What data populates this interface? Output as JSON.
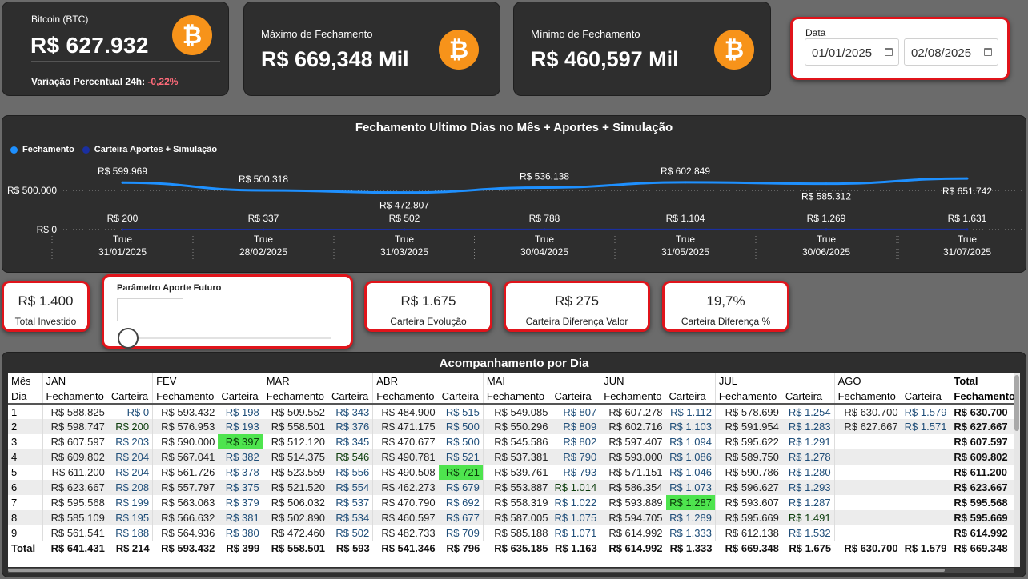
{
  "btc_card": {
    "title": "Bitcoin (BTC)",
    "price": "R$ 627.932",
    "variation_label": "Variação Percentual 24h:",
    "variation_value": "-0,22%",
    "icon": "bitcoin-icon"
  },
  "max_card": {
    "title": "Máximo de Fechamento",
    "value": "R$ 669,348 Mil",
    "icon": "bitcoin-icon"
  },
  "min_card": {
    "title": "Mínimo de Fechamento",
    "value": "R$ 460,597 Mil",
    "icon": "bitcoin-icon"
  },
  "date_filter": {
    "title": "Data",
    "start": "01/01/2025",
    "end": "02/08/2025"
  },
  "chart": {
    "title": "Fechamento Ultimo Dias no Mês + Aportes + Simulação",
    "legend": [
      {
        "name": "Fechamento",
        "color": "#1e90ff"
      },
      {
        "name": "Carteira Aportes + Simulação",
        "color": "#1a2fa0"
      }
    ],
    "y_ticks": [
      "R$ 500.000",
      "R$ 0"
    ],
    "x_labels_top": [
      "True",
      "True",
      "True",
      "True",
      "True",
      "True",
      "True"
    ],
    "x_labels_bottom": [
      "31/01/2025",
      "28/02/2025",
      "31/03/2025",
      "30/04/2025",
      "31/05/2025",
      "30/06/2025",
      "31/07/2025"
    ],
    "fech_labels": [
      "R$ 599.969",
      "R$ 500.318",
      "R$ 472.807",
      "R$ 536.138",
      "R$ 602.849",
      "R$ 585.312",
      "R$ 651.742"
    ],
    "cart_labels": [
      "R$ 200",
      "R$ 337",
      "R$ 502",
      "R$ 788",
      "R$ 1.104",
      "R$ 1.269",
      "R$ 1.631"
    ]
  },
  "chart_data": {
    "type": "line",
    "title": "Fechamento Ultimo Dias no Mês + Aportes + Simulação",
    "x": [
      "31/01/2025",
      "28/02/2025",
      "31/03/2025",
      "30/04/2025",
      "31/05/2025",
      "30/06/2025",
      "31/07/2025"
    ],
    "series": [
      {
        "name": "Fechamento",
        "values": [
          599969,
          500318,
          472807,
          536138,
          602849,
          585312,
          651742
        ]
      },
      {
        "name": "Carteira Aportes + Simulação",
        "values": [
          200,
          337,
          502,
          788,
          1104,
          1269,
          1631
        ]
      }
    ]
  },
  "kpis": {
    "total_investido": {
      "value": "R$ 1.400",
      "label": "Total Investido"
    },
    "evolucao": {
      "value": "R$ 1.675",
      "label": "Carteira Evolução"
    },
    "dif_valor": {
      "value": "R$ 275",
      "label": "Carteira Diferença Valor"
    },
    "dif_pct": {
      "value": "19,7%",
      "label": "Carteira Diferença %"
    }
  },
  "slider": {
    "title": "Parâmetro Aporte Futuro",
    "value": ""
  },
  "table": {
    "title": "Acompanhamento por Dia",
    "mes_label": "Mês",
    "dia_label": "Dia",
    "fech_label": "Fechamento",
    "cart_label": "Carteira",
    "total_label": "Total",
    "fech_total_label": "Fechamento",
    "months": [
      "JAN",
      "FEV",
      "MAR",
      "ABR",
      "MAI",
      "JUN",
      "JUL",
      "AGO"
    ],
    "rows": [
      {
        "dia": "1",
        "vals": [
          [
            "R$ 588.825",
            "R$ 0"
          ],
          [
            "R$ 593.432",
            "R$ 198"
          ],
          [
            "R$ 509.552",
            "R$ 343"
          ],
          [
            "R$ 484.900",
            "R$ 515"
          ],
          [
            "R$ 549.085",
            "R$ 807"
          ],
          [
            "R$ 607.278",
            "R$ 1.112"
          ],
          [
            "R$ 578.699",
            "R$ 1.254"
          ],
          [
            "R$ 630.700",
            "R$ 1.579"
          ]
        ],
        "total": "R$ 630.700"
      },
      {
        "dia": "2",
        "vals": [
          [
            "R$ 598.747",
            "R$ 200"
          ],
          [
            "R$ 576.953",
            "R$ 193"
          ],
          [
            "R$ 558.501",
            "R$ 376"
          ],
          [
            "R$ 471.175",
            "R$ 500"
          ],
          [
            "R$ 550.296",
            "R$ 809"
          ],
          [
            "R$ 602.716",
            "R$ 1.103"
          ],
          [
            "R$ 591.954",
            "R$ 1.283"
          ],
          [
            "R$ 627.667",
            "R$ 1.571"
          ]
        ],
        "total": "R$ 627.667"
      },
      {
        "dia": "3",
        "vals": [
          [
            "R$ 607.597",
            "R$ 203"
          ],
          [
            "R$ 590.000",
            "R$ 397"
          ],
          [
            "R$ 512.120",
            "R$ 345"
          ],
          [
            "R$ 470.677",
            "R$ 500"
          ],
          [
            "R$ 545.586",
            "R$ 802"
          ],
          [
            "R$ 597.407",
            "R$ 1.094"
          ],
          [
            "R$ 595.622",
            "R$ 1.291"
          ],
          [
            "",
            ""
          ]
        ],
        "total": "R$ 607.597"
      },
      {
        "dia": "4",
        "vals": [
          [
            "R$ 609.802",
            "R$ 204"
          ],
          [
            "R$ 567.041",
            "R$ 382"
          ],
          [
            "R$ 514.375",
            "R$ 546"
          ],
          [
            "R$ 490.781",
            "R$ 521"
          ],
          [
            "R$ 537.381",
            "R$ 790"
          ],
          [
            "R$ 593.000",
            "R$ 1.086"
          ],
          [
            "R$ 589.750",
            "R$ 1.278"
          ],
          [
            "",
            ""
          ]
        ],
        "total": "R$ 609.802"
      },
      {
        "dia": "5",
        "vals": [
          [
            "R$ 611.200",
            "R$ 204"
          ],
          [
            "R$ 561.726",
            "R$ 378"
          ],
          [
            "R$ 523.559",
            "R$ 556"
          ],
          [
            "R$ 490.508",
            "R$ 721"
          ],
          [
            "R$ 539.761",
            "R$ 793"
          ],
          [
            "R$ 571.151",
            "R$ 1.046"
          ],
          [
            "R$ 590.786",
            "R$ 1.280"
          ],
          [
            "",
            ""
          ]
        ],
        "total": "R$ 611.200"
      },
      {
        "dia": "6",
        "vals": [
          [
            "R$ 623.667",
            "R$ 208"
          ],
          [
            "R$ 557.797",
            "R$ 375"
          ],
          [
            "R$ 521.520",
            "R$ 554"
          ],
          [
            "R$ 462.273",
            "R$ 679"
          ],
          [
            "R$ 553.887",
            "R$ 1.014"
          ],
          [
            "R$ 586.354",
            "R$ 1.073"
          ],
          [
            "R$ 596.627",
            "R$ 1.293"
          ],
          [
            "",
            ""
          ]
        ],
        "total": "R$ 623.667"
      },
      {
        "dia": "7",
        "vals": [
          [
            "R$ 595.568",
            "R$ 199"
          ],
          [
            "R$ 563.063",
            "R$ 379"
          ],
          [
            "R$ 506.032",
            "R$ 537"
          ],
          [
            "R$ 470.790",
            "R$ 692"
          ],
          [
            "R$ 558.319",
            "R$ 1.022"
          ],
          [
            "R$ 593.889",
            "R$ 1.287"
          ],
          [
            "R$ 593.607",
            "R$ 1.287"
          ],
          [
            "",
            ""
          ]
        ],
        "total": "R$ 595.568"
      },
      {
        "dia": "8",
        "vals": [
          [
            "R$ 585.109",
            "R$ 195"
          ],
          [
            "R$ 566.632",
            "R$ 381"
          ],
          [
            "R$ 502.890",
            "R$ 534"
          ],
          [
            "R$ 460.597",
            "R$ 677"
          ],
          [
            "R$ 587.005",
            "R$ 1.075"
          ],
          [
            "R$ 594.705",
            "R$ 1.289"
          ],
          [
            "R$ 595.669",
            "R$ 1.491"
          ],
          [
            "",
            ""
          ]
        ],
        "total": "R$ 595.669"
      },
      {
        "dia": "9",
        "vals": [
          [
            "R$ 561.541",
            "R$ 188"
          ],
          [
            "R$ 564.936",
            "R$ 380"
          ],
          [
            "R$ 472.460",
            "R$ 502"
          ],
          [
            "R$ 482.733",
            "R$ 709"
          ],
          [
            "R$ 585.188",
            "R$ 1.071"
          ],
          [
            "R$ 614.992",
            "R$ 1.333"
          ],
          [
            "R$ 612.138",
            "R$ 1.532"
          ],
          [
            "",
            ""
          ]
        ],
        "total": "R$ 614.992"
      }
    ],
    "highlights": [
      [
        1,
        0
      ],
      [
        2,
        1
      ],
      [
        3,
        2
      ],
      [
        4,
        3
      ],
      [
        5,
        4
      ],
      [
        6,
        5
      ],
      [
        7,
        6
      ]
    ],
    "totals": {
      "label": "Total",
      "vals": [
        [
          "R$ 641.431",
          "R$ 214"
        ],
        [
          "R$ 593.432",
          "R$ 399"
        ],
        [
          "R$ 558.501",
          "R$ 593"
        ],
        [
          "R$ 541.346",
          "R$ 796"
        ],
        [
          "R$ 635.185",
          "R$ 1.163"
        ],
        [
          "R$ 614.992",
          "R$ 1.333"
        ],
        [
          "R$ 669.348",
          "R$ 1.675"
        ],
        [
          "R$ 630.700",
          "R$ 1.579"
        ]
      ],
      "total": "R$ 669.348"
    }
  }
}
